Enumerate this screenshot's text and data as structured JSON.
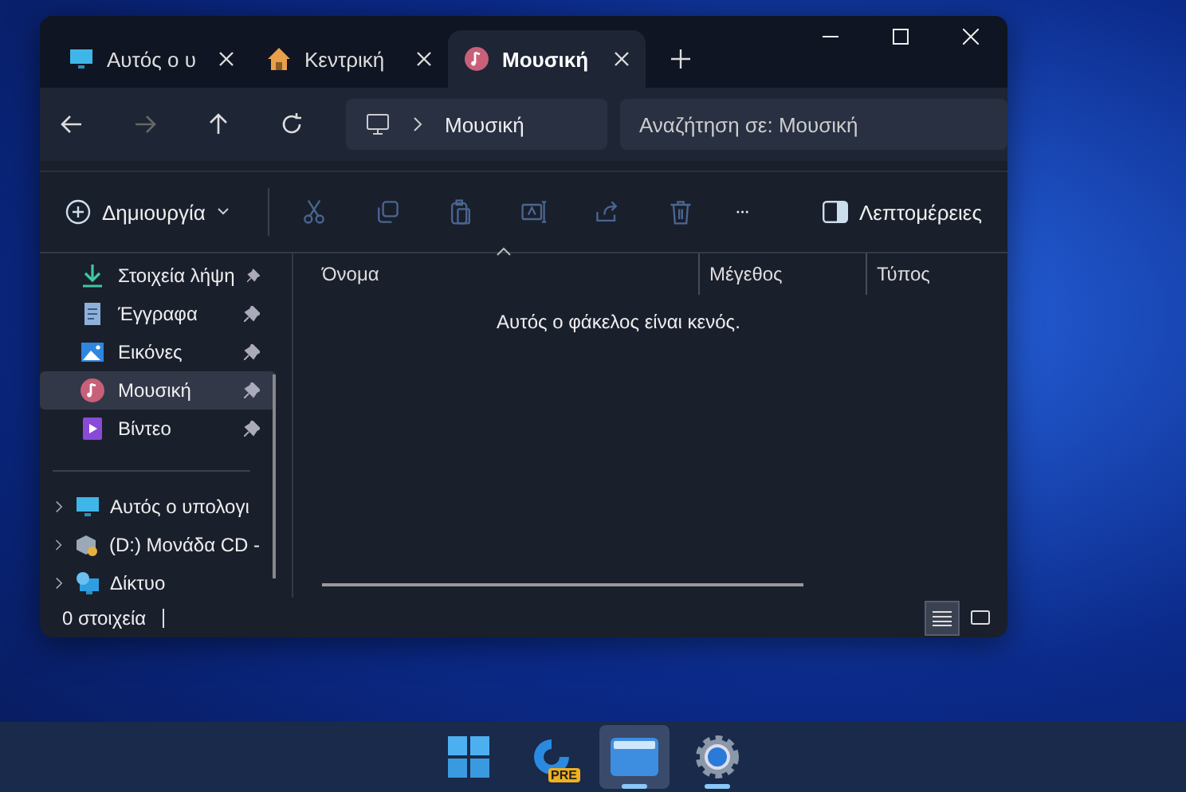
{
  "tabs": [
    {
      "kind": "computer",
      "label": "Αυτός ο υ",
      "selected": false
    },
    {
      "kind": "home",
      "label": "Κεντρική",
      "selected": false
    },
    {
      "kind": "music",
      "label": "Μουσική",
      "selected": true
    }
  ],
  "address": {
    "crumb": "Μουσική"
  },
  "search": {
    "placeholder": "Αναζήτηση σε: Μουσική"
  },
  "toolbar": {
    "new_label": "Δημιουργία",
    "actions": [
      {
        "kind": "cut",
        "disabled": true
      },
      {
        "kind": "copy",
        "disabled": true
      },
      {
        "kind": "paste",
        "disabled": true
      },
      {
        "kind": "rename",
        "disabled": true
      },
      {
        "kind": "share",
        "disabled": true
      },
      {
        "kind": "delete",
        "disabled": true
      }
    ],
    "details_label": "Λεπτομέρειες"
  },
  "quick_access": [
    {
      "kind": "download",
      "label": "Στοιχεία λήψη",
      "pinned": true,
      "selected": false
    },
    {
      "kind": "documents",
      "label": "Έγγραφα",
      "pinned": true,
      "selected": false
    },
    {
      "kind": "pictures",
      "label": "Εικόνες",
      "pinned": true,
      "selected": false
    },
    {
      "kind": "music",
      "label": "Μουσική",
      "pinned": true,
      "selected": true
    },
    {
      "kind": "video",
      "label": "Βίντεο",
      "pinned": true,
      "selected": false
    }
  ],
  "locations": [
    {
      "kind": "computer",
      "label": "Αυτός ο υπολογι",
      "expanded": false
    },
    {
      "kind": "drive",
      "label": "(D:) Μονάδα CD -",
      "expanded": false
    },
    {
      "kind": "network",
      "label": "Δίκτυο",
      "expanded": false
    }
  ],
  "columns": [
    {
      "label": "Όνομα",
      "sorted": true
    },
    {
      "label": "Μέγεθος",
      "sorted": false
    },
    {
      "label": "Τύπος",
      "sorted": false
    }
  ],
  "empty_message": "Αυτός ο φάκελος είναι κενός.",
  "status_bar": {
    "count": "0 στοιχεία",
    "views": [
      {
        "kind": "details",
        "selected": true
      },
      {
        "kind": "tiles",
        "selected": false
      }
    ]
  },
  "taskbar": [
    {
      "kind": "start",
      "selected": false,
      "running": false
    },
    {
      "kind": "copilot",
      "badge": "PRE",
      "selected": false,
      "running": false
    },
    {
      "kind": "explorer",
      "selected": true,
      "running": true
    },
    {
      "kind": "settings",
      "selected": false,
      "running": true
    }
  ]
}
